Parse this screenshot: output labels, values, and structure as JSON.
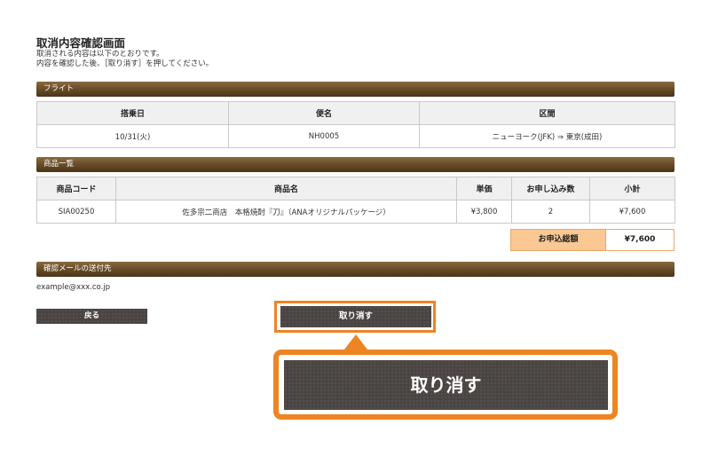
{
  "page": {
    "title": "取消内容確認画面",
    "desc_line1": "取消される内容は以下のとおりです。",
    "desc_line2": "内容を確認した後、［取り消す］を押してください。"
  },
  "flight": {
    "section_label": "フライト",
    "headers": [
      "搭乗日",
      "便名",
      "区間"
    ],
    "row": [
      "10/31(火)",
      "NH0005",
      "ニューヨーク(JFK) ⇒ 東京(成田)"
    ]
  },
  "products": {
    "section_label": "商品一覧",
    "headers": [
      "商品コード",
      "商品名",
      "単価",
      "お申し込み数",
      "小計"
    ],
    "row": [
      "SIA00250",
      "佐多宗二商店　本格焼酎『刀』（ANAオリジナルパッケージ）",
      "¥3,800",
      "2",
      "¥7,600"
    ],
    "total_label": "お申込総額",
    "total_value": "¥7,600"
  },
  "email": {
    "section_label": "確認メールの送付先",
    "address": "example@xxx.co.jp"
  },
  "buttons": {
    "back_label": "戻る",
    "cancel_label": "取り消す",
    "callout_label": "取り消す"
  },
  "colors": {
    "section_bar": "#6b4f2a",
    "highlight": "#ee8422",
    "total_bg": "#fbc894",
    "button": "#4a4543"
  }
}
